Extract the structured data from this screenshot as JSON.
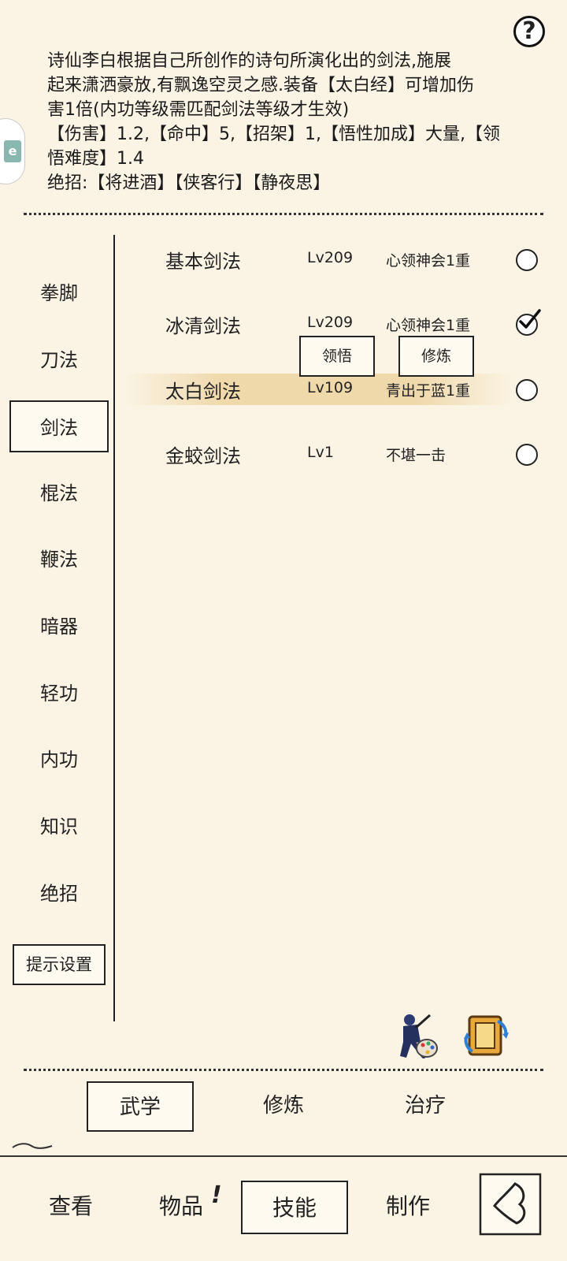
{
  "description": {
    "lines": [
      "诗仙李白根据自己所创作的诗句所演化出的剑法,施展",
      "起来潇洒豪放,有飘逸空灵之感.装备【太白经】可增加伤",
      "害1倍(内功等级需匹配剑法等级才生效)",
      "【伤害】1.2,【命中】5,【招架】1,【悟性加成】大量,【领",
      "悟难度】1.4",
      "绝招:【将进酒】【侠客行】【静夜思】"
    ]
  },
  "help_label": "?",
  "side_tab_label": "e",
  "categories": [
    {
      "label": "拳脚",
      "active": false
    },
    {
      "label": "刀法",
      "active": false
    },
    {
      "label": "剑法",
      "active": true
    },
    {
      "label": "棍法",
      "active": false
    },
    {
      "label": "鞭法",
      "active": false
    },
    {
      "label": "暗器",
      "active": false
    },
    {
      "label": "轻功",
      "active": false
    },
    {
      "label": "内功",
      "active": false
    },
    {
      "label": "知识",
      "active": false
    },
    {
      "label": "绝招",
      "active": false
    }
  ],
  "hint_settings_label": "提示设置",
  "skills": [
    {
      "name": "基本剑法",
      "level": "Lv209",
      "realm": "心领神会1重",
      "checked": false
    },
    {
      "name": "冰清剑法",
      "level": "Lv209",
      "realm": "心领神会1重",
      "checked": true
    },
    {
      "name": "太白剑法",
      "level": "Lv109",
      "realm": "青出于蓝1重",
      "checked": false
    },
    {
      "name": "金蛟剑法",
      "level": "Lv1",
      "realm": "不堪一击",
      "checked": false
    }
  ],
  "skill_actions": {
    "comprehend": "领悟",
    "practice": "修炼"
  },
  "icons": {
    "ninja_palette": "ninja-palette-icon",
    "swap_scroll": "swap-scroll-icon"
  },
  "sub_tabs": [
    {
      "label": "武学",
      "active": true
    },
    {
      "label": "修炼",
      "active": false
    },
    {
      "label": "治疗",
      "active": false
    }
  ],
  "bottom_nav": [
    {
      "label": "查看",
      "active": false
    },
    {
      "label": "物品",
      "active": false,
      "badge": "!"
    },
    {
      "label": "技能",
      "active": true
    },
    {
      "label": "制作",
      "active": false
    }
  ]
}
